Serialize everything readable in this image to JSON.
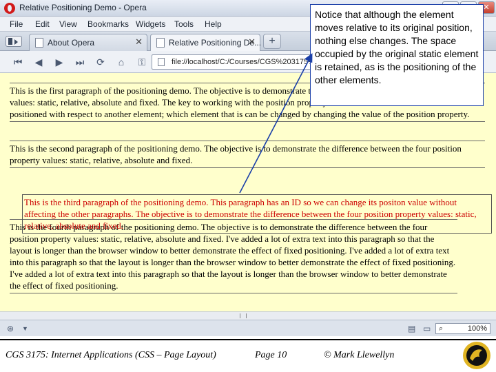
{
  "window": {
    "title": "Relative Positioning Demo - Opera",
    "controls": [
      "–",
      "□",
      "✕"
    ]
  },
  "menu": [
    "File",
    "Edit",
    "View",
    "Bookmarks",
    "Widgets",
    "Tools",
    "Help"
  ],
  "tabs": [
    {
      "label": "About Opera",
      "close": "✕"
    },
    {
      "label": "Relative Positioning De...",
      "close": "✕"
    }
  ],
  "new_tab_label": "+",
  "address_bar": "file://localhost/C:/Courses/CGS%203175%20-%20Fall%202009/Code/relativepositioning.html",
  "paragraphs": {
    "p1": "This is the first paragraph of the positioning demo. The objective is to demonstrate the difference between the four position property values: static, relative, absolute and fixed. The key to working with the position property is to understand that the element is positioned with respect to another element; which element that is can be changed by changing the value of the position property.",
    "p2": "This is the second paragraph of the positioning demo. The objective is to demonstrate the difference between the four position property values: static, relative, absolute and fixed.",
    "p3": "This is the third paragraph of the positioning demo. This paragraph has an ID so we can change its positon value without affecting the other paragraphs. The objective is to demonstrate the difference between the four position property values: static, relative, absolute and fixed.",
    "p4": "This is the fourth paragraph of the positioning demo. The objective is to demonstrate the difference between the four position property values: static, relative, absolute and fixed. I've added a lot of extra text into this paragraph so that the layout is longer than the browser window to better demonstrate the effect of fixed positioning. I've added a lot of extra text into this paragraph so that the layout is longer than the browser window to better demonstrate the effect of fixed positioning. I've added a lot of extra text into this paragraph so that the layout is longer than the browser window to better demonstrate the effect of fixed positioning."
  },
  "zoom": "100%",
  "callout": "Notice that although the element moves relative to its original position, nothing else changes. The space occupied by the original static element is retained, as is the positioning of the other elements.",
  "footer": {
    "course": "CGS 3175: Internet Applications (CSS – Page Layout)",
    "page": "Page 10",
    "author": "© Mark Llewellyn"
  },
  "colors": {
    "page_background": "#ffffcc",
    "highlighted_paragraph_text": "#cc0000",
    "callout_border": "#1a3fa8"
  }
}
